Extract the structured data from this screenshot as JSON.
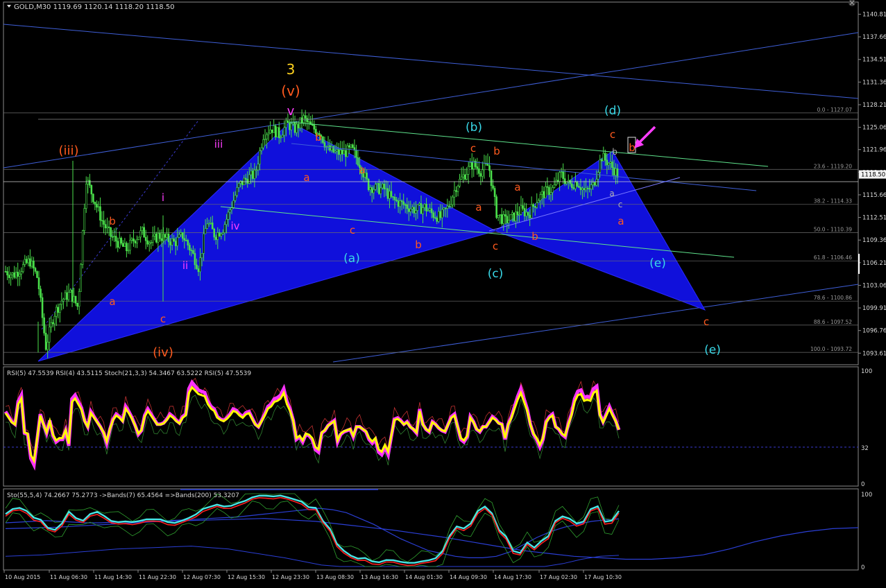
{
  "window": {
    "title": "GOLD,M30  1119.69 1120.14 1118.20 1118.50",
    "current_price": "1118.50"
  },
  "colors": {
    "background": "#000000",
    "grid_border": "#8a8a8a",
    "candle": "#4be14b",
    "pattern_fill": "#1111ee",
    "channel_line": "#3f5fd8",
    "fib_line": "#6f6f6f",
    "green_line": "#5fe38c",
    "rsi_magenta": "#ff33ff",
    "rsi_yellow": "#ffff00",
    "stoch_red": "#ff2020",
    "stoch_cyan": "#49e6e6",
    "wave_orange": "#ff5a1e",
    "wave_cyan": "#39d9e8",
    "wave_magenta": "#ff3dff",
    "wave_gold": "#ffd21e",
    "arrow": "#ff3dff"
  },
  "chart_data": [
    {
      "type": "candlestick",
      "title": "GOLD,M30",
      "ohlc_last": {
        "open": 1119.69,
        "high": 1120.14,
        "low": 1118.2,
        "close": 1118.5
      },
      "ylim": [
        1092.0,
        1142.5
      ],
      "y_ticks": [
        "1140.81",
        "1137.66",
        "1134.51",
        "1131.36",
        "1128.21",
        "1125.06",
        "1121.96",
        "1118.81",
        "1115.66",
        "1112.51",
        "1109.36",
        "1106.21",
        "1103.06",
        "1099.91",
        "1096.76",
        "1093.61"
      ],
      "close_path": [
        1105,
        1104.5,
        1105.5,
        1106.5,
        1104,
        1094.5,
        1099,
        1101,
        1102,
        1100,
        1118,
        1115,
        1112,
        1110,
        1109,
        1108,
        1109.5,
        1110.5,
        1109,
        1110,
        1109.5,
        1109,
        1110,
        1108,
        1105.5,
        1112,
        1110,
        1111,
        1114,
        1117,
        1118,
        1118.5,
        1124,
        1125,
        1124,
        1125.5,
        1124.8,
        1126.3,
        1125,
        1124.5,
        1122,
        1121.5,
        1121.5,
        1122,
        1120,
        1117,
        1116.5,
        1116.5,
        1115,
        1114.5,
        1114,
        1113.5,
        1114,
        1113,
        1112.5,
        1114,
        1117,
        1118.5,
        1120,
        1119,
        1119.8,
        1113,
        1112,
        1112.5,
        1113.5,
        1113,
        1115,
        1116,
        1116.5,
        1118.5,
        1117,
        1117.5,
        1116,
        1117,
        1121,
        1120,
        1118.5
      ],
      "fibonacci": [
        {
          "level": "0.0",
          "price": 1127.07,
          "label": "0.0 - 1127.07"
        },
        {
          "level": "23.6",
          "price": 1119.2,
          "label": "23.6 - 1119.20"
        },
        {
          "level": "38.2",
          "price": 1114.33,
          "label": "38.2 - 1114.33"
        },
        {
          "level": "50.0",
          "price": 1110.39,
          "label": "50.0 - 1110.39"
        },
        {
          "level": "61.8",
          "price": 1106.46,
          "label": "61.8 - 1106.46"
        },
        {
          "level": "78.6",
          "price": 1100.86,
          "label": "78.6 - 1100.86"
        },
        {
          "level": "88.6",
          "price": 1097.52,
          "label": "88.6 - 1097.52"
        },
        {
          "level": "100.0",
          "price": 1093.72,
          "label": "100.0 - 1093.72"
        }
      ],
      "x_ticks": [
        "10 Aug 2015",
        "11 Aug 06:30",
        "11 Aug 14:30",
        "11 Aug 22:30",
        "12 Aug 07:30",
        "12 Aug 15:30",
        "12 Aug 23:30",
        "13 Aug 08:30",
        "13 Aug 16:30",
        "14 Aug 01:30",
        "14 Aug 09:30",
        "14 Aug 17:30",
        "17 Aug 02:30",
        "17 Aug 10:30"
      ],
      "annotations": [
        {
          "text": "3",
          "color": "wave_gold"
        },
        {
          "text": "(v)",
          "color": "wave_orange"
        },
        {
          "text": "v",
          "color": "wave_magenta"
        },
        {
          "text": "(iii)",
          "color": "wave_orange"
        },
        {
          "text": "iii",
          "color": "wave_magenta"
        },
        {
          "text": "i",
          "color": "wave_magenta"
        },
        {
          "text": "ii",
          "color": "wave_magenta"
        },
        {
          "text": "iv",
          "color": "wave_magenta"
        },
        {
          "text": "(iv)",
          "color": "wave_orange"
        },
        {
          "text": "b",
          "color": "wave_orange"
        },
        {
          "text": "a",
          "color": "wave_orange"
        },
        {
          "text": "c",
          "color": "wave_orange"
        },
        {
          "text": "b",
          "color": "wave_orange"
        },
        {
          "text": "a",
          "color": "wave_orange"
        },
        {
          "text": "a",
          "color": "wave_orange"
        },
        {
          "text": "c",
          "color": "wave_orange"
        },
        {
          "text": "b",
          "color": "wave_orange"
        },
        {
          "text": "(a)",
          "color": "wave_cyan"
        },
        {
          "text": "(b)",
          "color": "wave_cyan"
        },
        {
          "text": "c",
          "color": "wave_orange"
        },
        {
          "text": "b",
          "color": "wave_orange"
        },
        {
          "text": "a",
          "color": "wave_orange"
        },
        {
          "text": "a",
          "color": "wave_orange"
        },
        {
          "text": "c",
          "color": "wave_orange"
        },
        {
          "text": "(c)",
          "color": "wave_cyan"
        },
        {
          "text": "b",
          "color": "wave_orange"
        },
        {
          "text": "(d)",
          "color": "wave_cyan"
        },
        {
          "text": "c",
          "color": "wave_orange"
        },
        {
          "text": "b",
          "color": "wave_orange"
        },
        {
          "text": "b",
          "color": "gray"
        },
        {
          "text": "a",
          "color": "gray"
        },
        {
          "text": "c",
          "color": "gray"
        },
        {
          "text": "a",
          "color": "wave_orange"
        },
        {
          "text": "(e)",
          "color": "wave_cyan"
        },
        {
          "text": "c",
          "color": "wave_orange"
        },
        {
          "text": "(e)",
          "color": "wave_cyan"
        }
      ]
    },
    {
      "type": "line",
      "title": "RSI(5) 47.5539  RSI(4) 43.5115  Stoch(21,3,3) 54.3467 63.5222  RSI(5) 47.5539",
      "ylim": [
        0,
        100
      ],
      "y_ticks": [
        "100",
        "32",
        "0"
      ],
      "level_line": 32,
      "series": [
        {
          "name": "RSI(5)",
          "values": [
            62,
            58,
            54,
            52,
            70,
            75,
            45,
            44,
            25,
            20,
            40,
            60,
            52,
            45,
            55,
            43,
            38,
            40,
            40,
            47,
            35,
            72,
            75,
            70,
            65,
            55,
            50,
            62,
            58,
            54,
            50,
            45,
            37,
            48,
            56,
            60,
            58,
            55,
            66,
            62,
            57,
            51,
            44,
            47,
            59,
            64,
            60,
            56,
            52,
            52,
            53,
            56,
            60,
            58,
            55,
            53,
            58,
            60,
            80,
            85,
            82,
            79,
            78,
            77,
            70,
            66,
            64,
            58,
            56,
            55,
            57,
            60,
            64,
            63,
            60,
            58,
            61,
            62,
            57,
            52,
            50,
            55,
            60,
            66,
            68,
            72,
            73,
            75,
            80,
            70,
            64,
            55,
            40,
            42,
            38,
            44,
            43,
            40,
            32,
            30,
            45,
            47,
            51,
            53,
            55,
            38,
            44,
            46,
            47,
            48,
            42,
            50,
            50,
            48,
            46,
            40,
            37,
            40,
            30,
            28,
            34,
            28,
            42,
            56,
            57,
            55,
            52,
            54,
            50,
            48,
            45,
            64,
            52,
            48,
            46,
            54,
            52,
            49,
            47,
            46,
            52,
            58,
            60,
            50,
            40,
            38,
            42,
            58,
            54,
            48,
            46,
            50,
            50,
            54,
            58,
            56,
            53,
            52,
            40,
            52,
            58,
            66,
            74,
            80,
            72,
            64,
            52,
            44,
            40,
            34,
            40,
            54,
            58,
            60,
            50,
            48,
            44,
            42,
            52,
            60,
            72,
            78,
            79,
            73,
            74,
            73,
            80,
            82,
            60,
            54,
            60,
            66,
            60,
            55,
            47.55
          ]
        }
      ]
    },
    {
      "type": "line",
      "title": "Sto(55,5,4) 74.2667 75.2773  ->Bands(7) 65.4564  =>Bands(200) 53.3207",
      "ylim": [
        0,
        100
      ],
      "y_ticks": [
        "100",
        "0"
      ],
      "series": [
        {
          "name": "Sto(55,5,4)",
          "values": [
            70,
            76,
            78,
            75,
            66,
            62,
            50,
            48,
            58,
            74,
            64,
            60,
            70,
            74,
            68,
            60,
            58,
            60,
            60,
            61,
            62,
            62,
            63,
            60,
            58,
            60,
            64,
            70,
            78,
            80,
            82,
            80,
            82,
            86,
            88,
            92,
            95,
            96,
            95,
            95,
            92,
            90,
            88,
            80,
            78,
            60,
            50,
            30,
            20,
            12,
            8,
            10,
            6,
            4,
            6,
            6,
            5,
            4,
            3,
            4,
            6,
            10,
            20,
            40,
            52,
            50,
            58,
            75,
            80,
            70,
            48,
            40,
            20,
            16,
            30,
            24,
            34,
            40,
            60,
            66,
            64,
            58,
            60,
            76,
            80,
            60,
            62,
            74.27
          ]
        },
        {
          "name": "Bands(7)",
          "values": [
            60,
            61,
            62,
            63,
            62,
            61,
            60,
            60,
            61,
            61,
            62,
            62,
            63,
            64,
            65,
            66,
            67,
            68,
            70,
            72,
            74,
            76,
            78,
            80,
            78,
            74,
            66,
            58,
            48,
            38,
            30,
            22,
            18,
            14,
            12,
            12,
            14,
            20,
            30,
            40,
            48,
            54,
            58,
            62,
            64,
            65.46
          ]
        },
        {
          "name": "Bands(200)",
          "values": [
            52,
            53,
            54,
            56,
            58,
            60,
            62,
            63,
            64,
            65,
            66,
            64,
            62,
            58,
            54,
            50,
            45,
            40,
            34,
            28,
            22,
            18,
            14,
            12,
            10,
            10,
            12,
            16,
            24,
            34,
            42,
            48,
            52,
            53.32
          ]
        }
      ]
    }
  ]
}
